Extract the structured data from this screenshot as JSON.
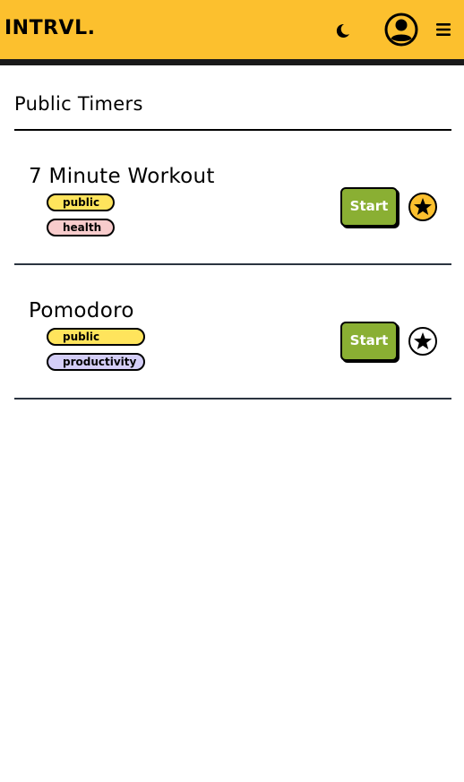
{
  "app": {
    "logo": "INTRVL.",
    "colors": {
      "header": "#FCC02E",
      "start_button": "#8AAF33",
      "favorite_fill": "#FCC02E",
      "tag_public": "#FFE45C",
      "tag_health": "#F8CCCC",
      "tag_productivity": "#D4CEF7"
    }
  },
  "header": {
    "theme_toggle_icon": "moon-icon",
    "profile_icon": "user-circle-icon",
    "menu_icon": "hamburger-icon"
  },
  "main": {
    "title": "Public Timers",
    "timers": [
      {
        "name": "7 Minute Workout",
        "tags": [
          "public",
          "health"
        ],
        "start_label": "Start",
        "favorited": true
      },
      {
        "name": "Pomodoro",
        "tags": [
          "public",
          "productivity"
        ],
        "start_label": "Start",
        "favorited": false
      }
    ]
  }
}
